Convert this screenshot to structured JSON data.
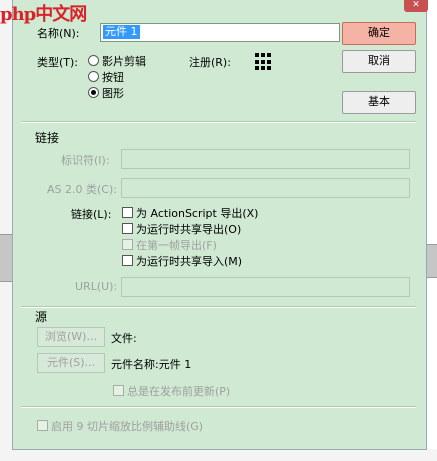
{
  "watermark": "php中文网",
  "close_glyph": "✕",
  "name": {
    "label": "名称(N):",
    "value": "元件 1"
  },
  "type": {
    "label": "类型(T):",
    "options": [
      "影片剪辑",
      "按钮",
      "图形"
    ],
    "selected": "图形"
  },
  "registration_label": "注册(R):",
  "buttons": {
    "ok": "确定",
    "cancel": "取消",
    "basic": "基本"
  },
  "linkage": {
    "title": "链接",
    "identifier_label": "标识符(I):",
    "as20_class_label": "AS 2.0 类(C):",
    "linkage_label": "链接(L):",
    "options": [
      "为 ActionScript 导出(X)",
      "为运行时共享导出(O)",
      "在第一帧导出(F)",
      "为运行时共享导入(M)"
    ],
    "url_label": "URL(U):"
  },
  "source": {
    "title": "源",
    "browse_button": "浏览(W)...",
    "file_label": "文件:",
    "symbol_button": "元件(S)...",
    "symbol_name_label": "元件名称:元件 1",
    "always_update_label": "总是在发布前更新(P)"
  },
  "enable_9slice_label": "启用 9 切片缩放比例辅助线(G)"
}
